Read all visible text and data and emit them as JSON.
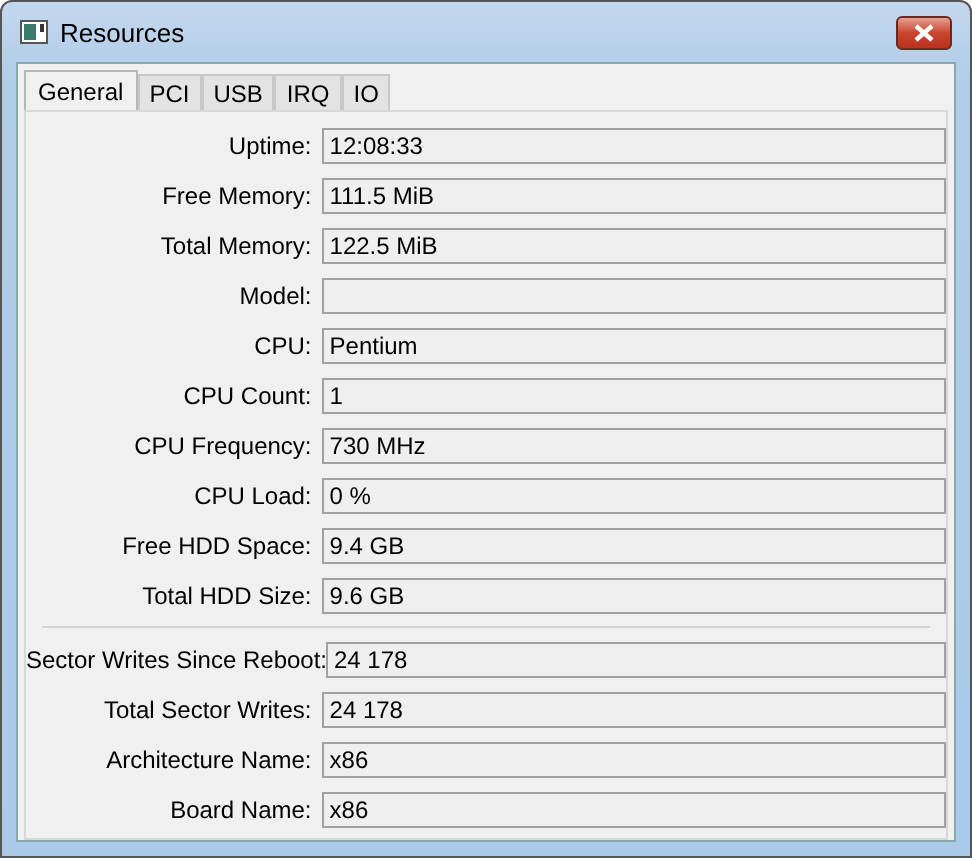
{
  "window": {
    "title": "Resources"
  },
  "tabs": [
    {
      "label": "General",
      "selected": true
    },
    {
      "label": "PCI",
      "selected": false
    },
    {
      "label": "USB",
      "selected": false
    },
    {
      "label": "IRQ",
      "selected": false
    },
    {
      "label": "IO",
      "selected": false
    }
  ],
  "groups": [
    [
      {
        "label": "Uptime:",
        "value": "12:08:33"
      },
      {
        "label": "Free Memory:",
        "value": "111.5 MiB"
      },
      {
        "label": "Total Memory:",
        "value": "122.5 MiB"
      },
      {
        "label": "Model:"
      },
      {
        "label": "CPU:",
        "value": "Pentium"
      },
      {
        "label": "CPU Count:",
        "value": "1"
      },
      {
        "label": "CPU Frequency:",
        "value": "730 MHz"
      },
      {
        "label": "CPU Load:",
        "value": "0 %"
      },
      {
        "label": "Free HDD Space:",
        "value": "9.4 GB"
      },
      {
        "label": "Total HDD Size:",
        "value": "9.6 GB"
      }
    ],
    [
      {
        "label": "Sector Writes Since Reboot:",
        "value": "24 178"
      },
      {
        "label": "Total Sector Writes:",
        "value": "24 178"
      },
      {
        "label": "Architecture Name:",
        "value": "x86"
      },
      {
        "label": "Board Name:",
        "value": "x86"
      }
    ]
  ]
}
